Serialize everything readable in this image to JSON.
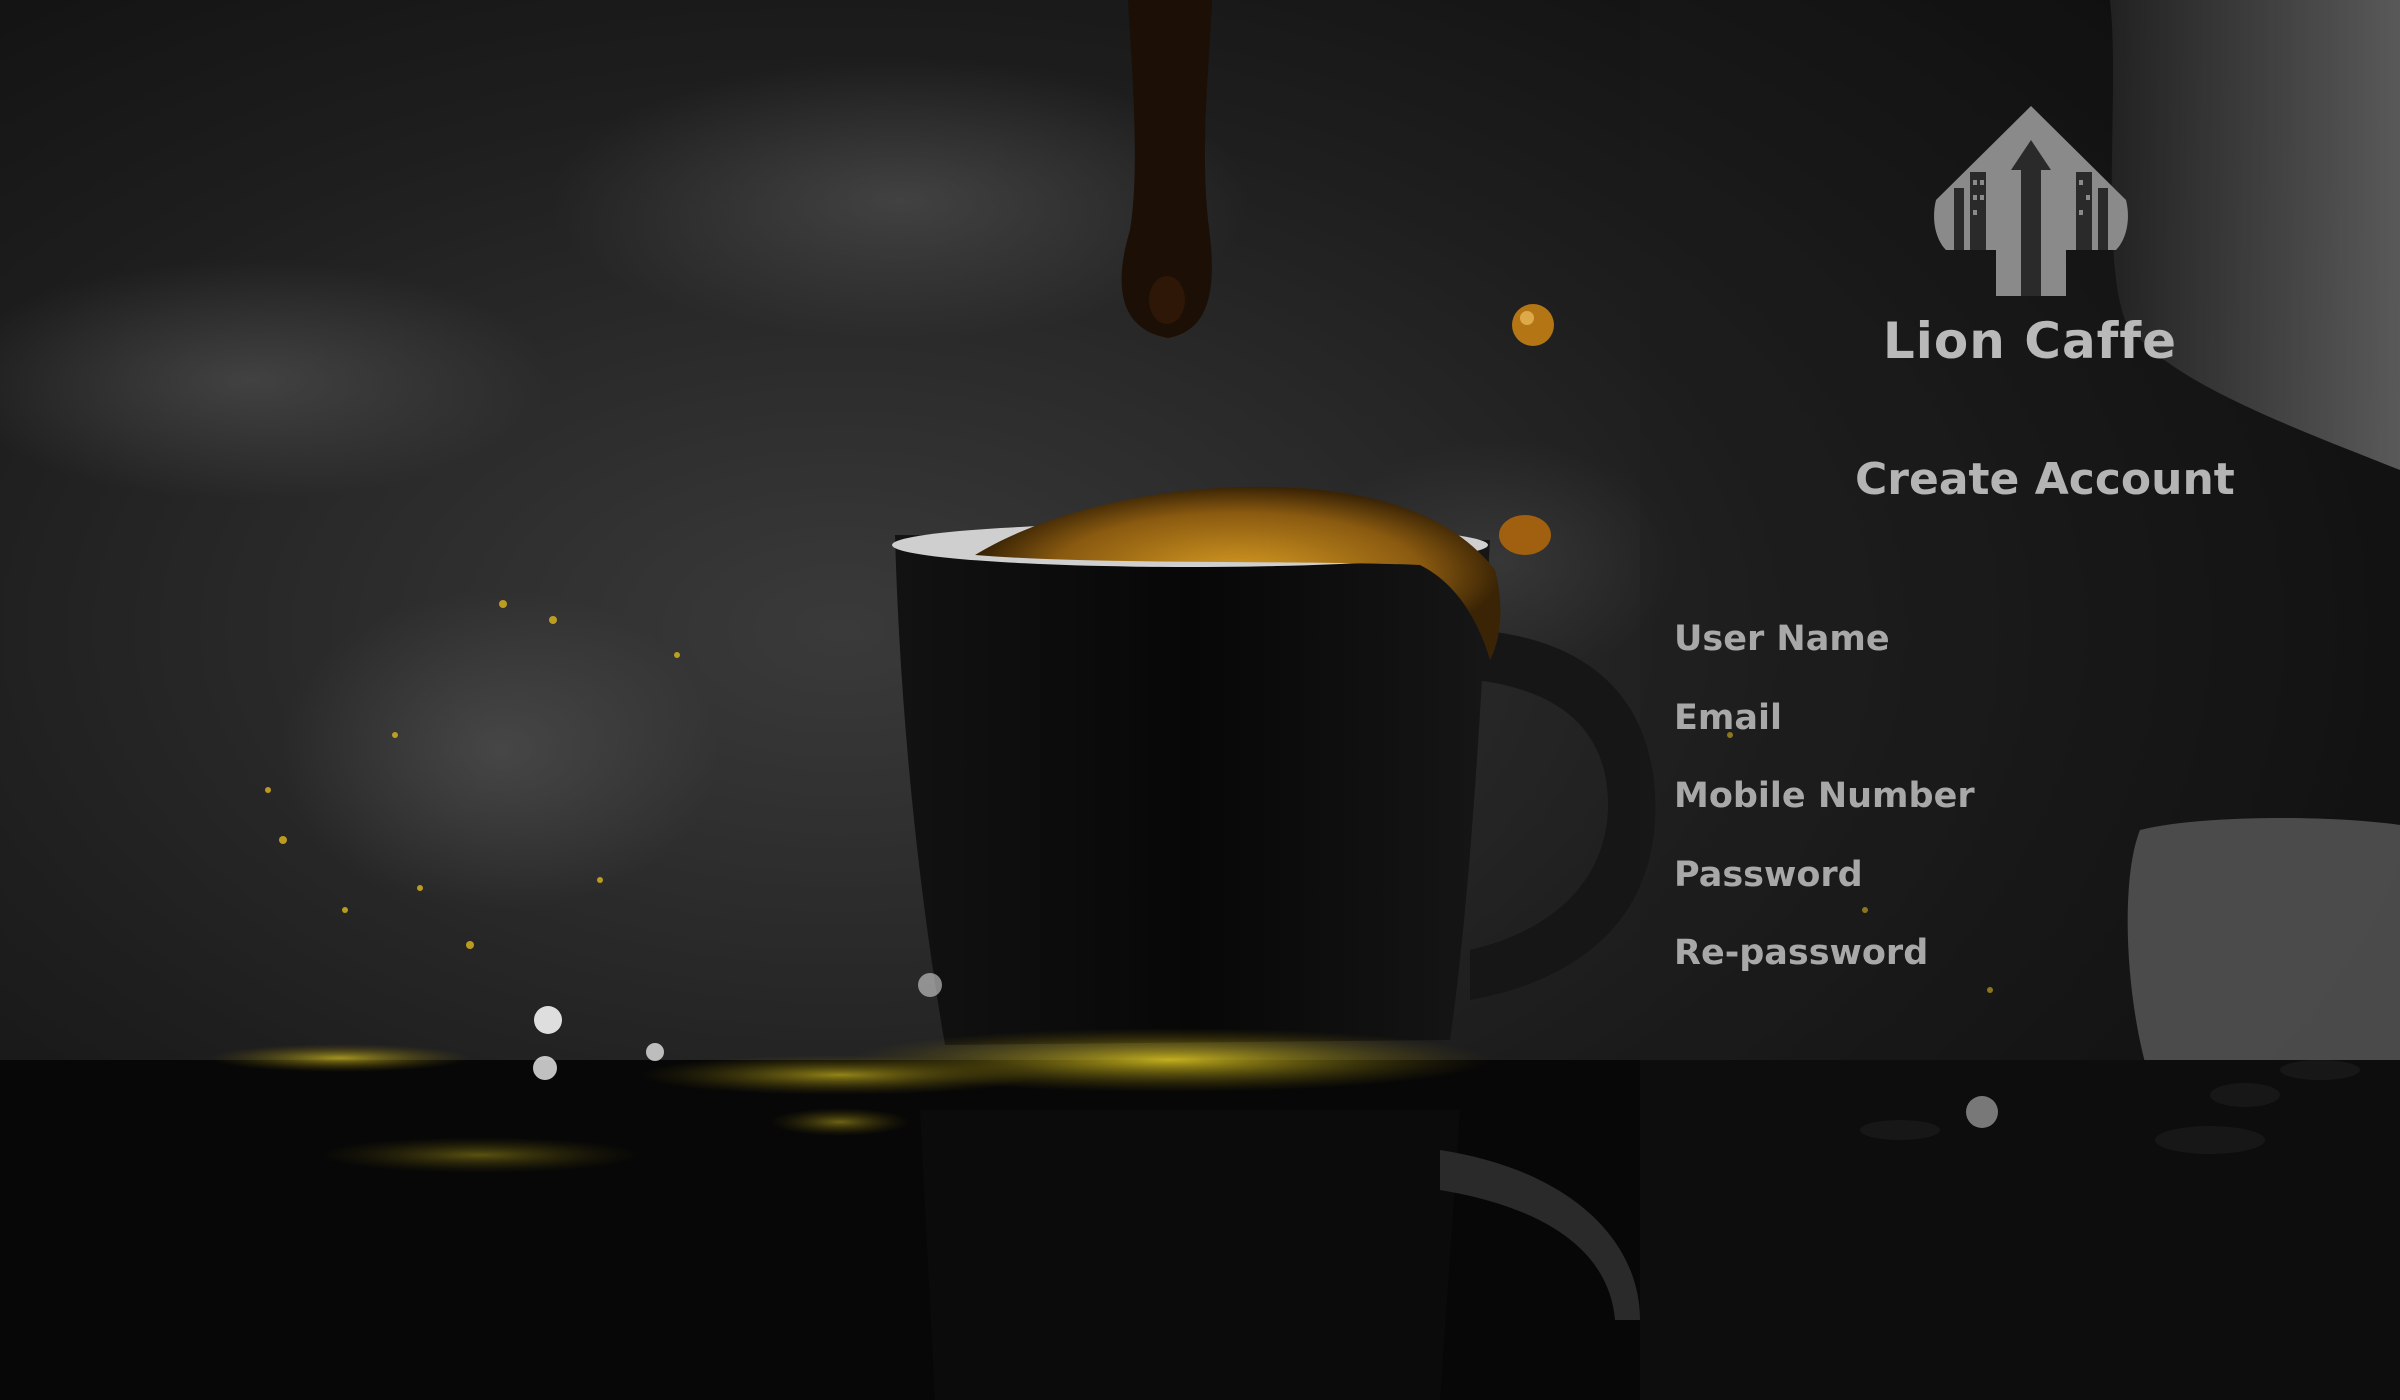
{
  "brand": {
    "name": "Lion Caffe"
  },
  "form": {
    "title": "Create Account",
    "fields": [
      {
        "label": "User Name"
      },
      {
        "label": "Email"
      },
      {
        "label": "Mobile Number"
      },
      {
        "label": "Password"
      },
      {
        "label": "Re-password"
      }
    ]
  },
  "colors": {
    "coffee_gold": "#c08a1a",
    "text_gray": "#b4b4b4",
    "background": "#0b0b0b"
  },
  "icons": {
    "logo": "lion-caffe-logo-icon"
  }
}
